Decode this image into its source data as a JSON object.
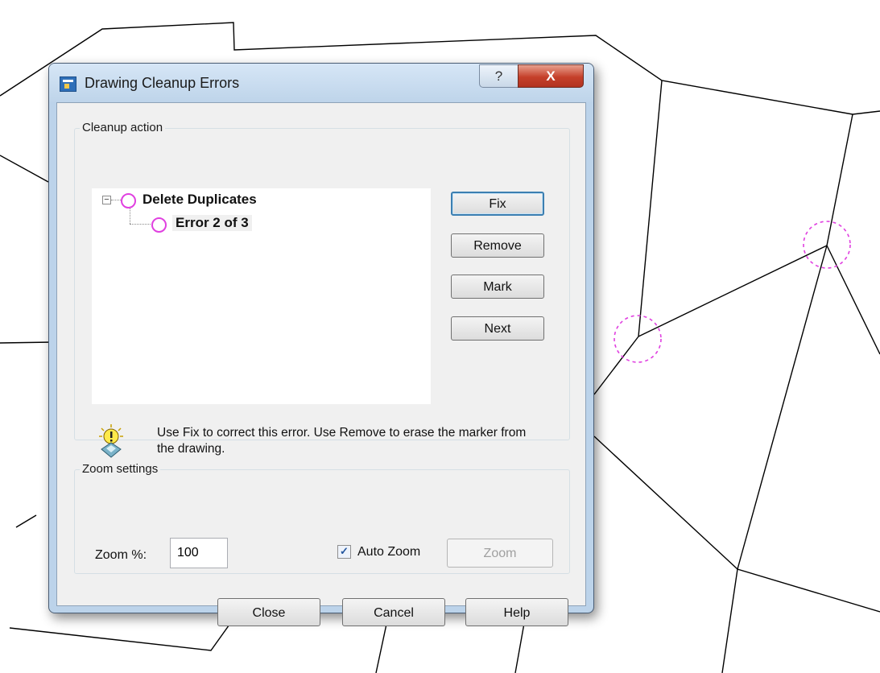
{
  "window": {
    "title": "Drawing Cleanup Errors",
    "help_glyph": "?",
    "close_glyph": "X"
  },
  "cleanup": {
    "group_label": "Cleanup action",
    "tree": {
      "root_label": "Delete Duplicates",
      "child_label": "Error 2 of 3",
      "expander_glyph": "−"
    },
    "buttons": {
      "fix_label": "Fix",
      "remove_label": "Remove",
      "mark_label": "Mark",
      "next_label": "Next"
    },
    "hint_text": "Use Fix to correct this error. Use Remove to erase the  marker from the drawing.",
    "hint_icon": "lightbulb-icon"
  },
  "zoom": {
    "group_label": "Zoom settings",
    "zoom_percent_label": "Zoom %:",
    "zoom_percent_value": "100",
    "auto_zoom_label": "Auto Zoom",
    "auto_zoom_checked": true,
    "zoom_button_label": "Zoom"
  },
  "footer": {
    "close_label": "Close",
    "cancel_label": "Cancel",
    "help_label": "Help"
  },
  "colors": {
    "error_marker": "#e040e0",
    "close_button": "#c5402a",
    "titlebar": "#bcd3ea"
  }
}
